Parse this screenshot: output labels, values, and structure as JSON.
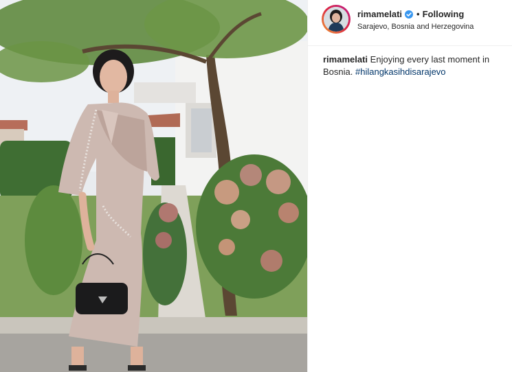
{
  "post": {
    "username": "rimamelati",
    "verified_icon": "verified-badge-icon",
    "separator": "•",
    "follow_status": "Following",
    "location": "Sarajevo, Bosnia and Herzegovina",
    "caption_text": "Enjoying every last moment in Bosnia.",
    "hashtag": "#hilangkasihdisarajevo"
  },
  "colors": {
    "verified": "#3897f0",
    "hashtag": "#003569",
    "text": "#262626",
    "divider": "#efefef"
  }
}
